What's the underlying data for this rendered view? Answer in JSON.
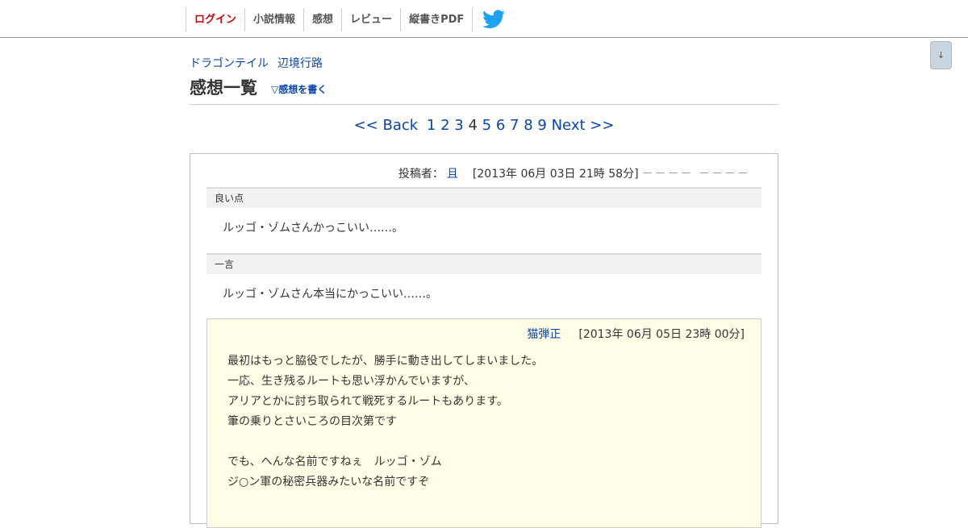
{
  "nav": {
    "items": [
      "ログイン",
      "小説情報",
      "感想",
      "レビュー",
      "縦書きPDF"
    ],
    "twitter_icon": "twitter-bird-icon",
    "twitter_color": "#1da1f2",
    "login_color": "#cc0000"
  },
  "scroll_button": {
    "label": "↓"
  },
  "breadcrumb": {
    "series": "ドラゴンテイル",
    "story": "辺境行路"
  },
  "page": {
    "title": "感想一覧",
    "write_link": "▽感想を書く"
  },
  "pager": {
    "back": "<< Back",
    "pages": [
      "1",
      "2",
      "3",
      "4",
      "5",
      "6",
      "7",
      "8",
      "9"
    ],
    "current": "4",
    "next": "Next >>"
  },
  "review": {
    "author_label": "投稿者：",
    "author": "且",
    "date": "[2013年 06月 03日 21時 58分]",
    "rating_marks": "－－－－ －－－－",
    "sections": [
      {
        "heading": "良い点",
        "body": "ルッゴ・ゾムさんかっこいい……。"
      },
      {
        "heading": "一言",
        "body": "ルッゴ・ゾムさん本当にかっこいい……。"
      }
    ],
    "reply": {
      "author": "猫弾正",
      "date": "[2013年 06月 05日 23時 00分]",
      "lines": [
        "最初はもっと脇役でしたが、勝手に動き出してしまいました。",
        "一応、生き残るルートも思い浮かんでいますが、",
        "アリアとかに討ち取られて戦死するルートもあります。",
        "筆の乗りとさいころの目次第です",
        "",
        "でも、へんな名前ですねぇ　ルッゴ・ゾム",
        "ジ○ン軍の秘密兵器みたいな名前ですぞ"
      ],
      "background": "#ffffe8"
    }
  }
}
